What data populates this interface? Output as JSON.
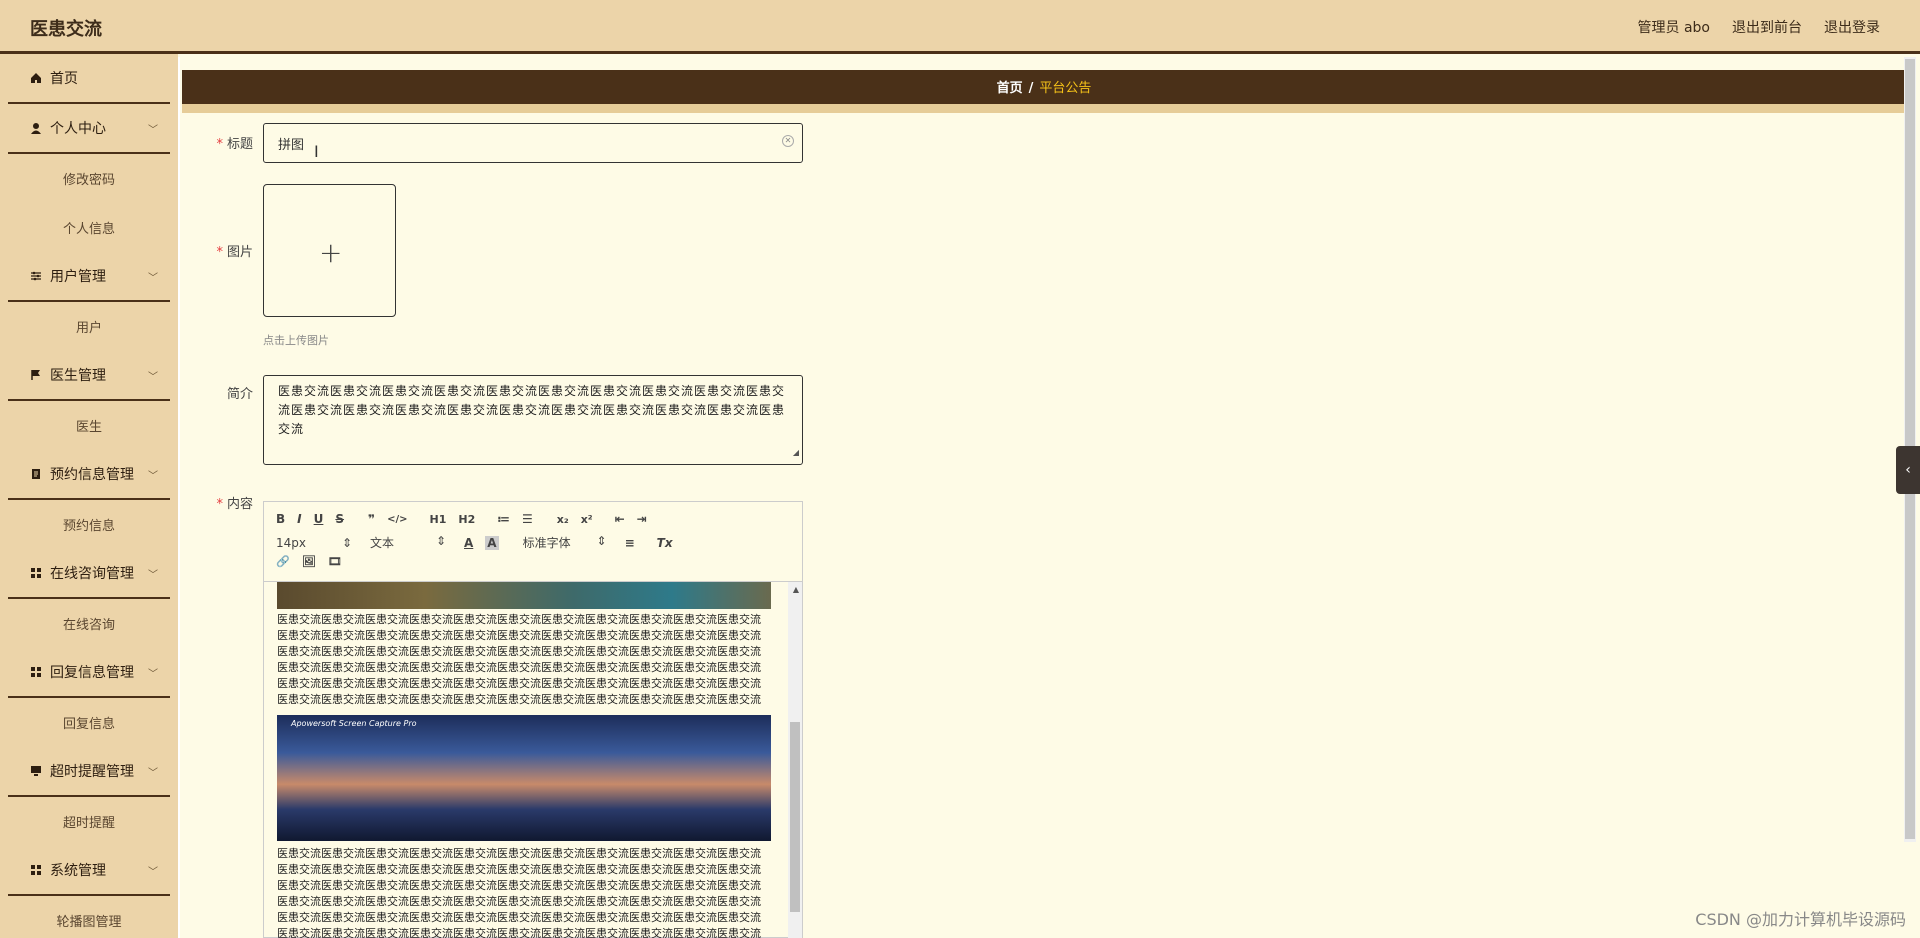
{
  "header": {
    "brand": "医患交流",
    "nav": [
      "管理员 abo",
      "退出到前台",
      "退出登录"
    ]
  },
  "sidebar": {
    "sections": [
      {
        "label": "首页",
        "icon": "home-icon",
        "has_arrow": false,
        "items": []
      },
      {
        "label": "个人中心",
        "icon": "user-icon",
        "has_arrow": true,
        "items": [
          "修改密码",
          "个人信息"
        ]
      },
      {
        "label": "用户管理",
        "icon": "sliders-icon",
        "has_arrow": true,
        "items": [
          "用户"
        ]
      },
      {
        "label": "医生管理",
        "icon": "flag-icon",
        "has_arrow": true,
        "items": [
          "医生"
        ]
      },
      {
        "label": "预约信息管理",
        "icon": "document-icon",
        "has_arrow": true,
        "items": [
          "预约信息"
        ]
      },
      {
        "label": "在线咨询管理",
        "icon": "grid-icon",
        "has_arrow": true,
        "items": [
          "在线咨询"
        ]
      },
      {
        "label": "回复信息管理",
        "icon": "grid-icon",
        "has_arrow": true,
        "items": [
          "回复信息"
        ]
      },
      {
        "label": "超时提醒管理",
        "icon": "monitor-icon",
        "has_arrow": true,
        "items": [
          "超时提醒"
        ]
      },
      {
        "label": "系统管理",
        "icon": "grid-icon",
        "has_arrow": true,
        "items": [
          "轮播图管理"
        ]
      }
    ]
  },
  "breadcrumb": {
    "home": "首页",
    "separator": "/",
    "current": "平台公告"
  },
  "form": {
    "title_label": "标题",
    "title_value": "拼图",
    "image_label": "图片",
    "upload_tip": "点击上传图片",
    "intro_label": "简介",
    "intro_value": "医患交流医患交流医患交流医患交流医患交流医患交流医患交流医患交流医患交流医患交流医患交流医患交流医患交流医患交流医患交流医患交流医患交流医患交流医患交流医患交流",
    "content_label": "内容"
  },
  "editor": {
    "toolbar_row1": [
      "B",
      "I",
      "U",
      "S",
      "❞",
      "</>",
      "H1",
      "H2",
      "≔",
      "☰",
      "x₂",
      "x²",
      "⇤",
      "⇥"
    ],
    "font_size": "14px",
    "text_style": "文本",
    "font_family": "标准字体",
    "toolbar_row2_icons": [
      "A",
      "A",
      "≡",
      "Tx"
    ],
    "toolbar_row3": [
      "🔗",
      "🖼",
      "🎞"
    ],
    "content_text": "医患交流医患交流医患交流医患交流医患交流医患交流医患交流医患交流医患交流医患交流医患交流医患交流医患交流医患交流医患交流医患交流医患交流医患交流医患交流医患交流医患交流医患交流医患交流医患交流医患交流医患交流医患交流医患交流医患交流医患交流医患交流医患交流医患交流医患交流医患交流医患交流医患交流医患交流医患交流医患交流医患交流医患交流医患交流医患交流医患交流医患交流医患交流医患交流医患交流医患交流医患交流医患交流医患交流医患交流医患交流医患交流医患交流医患交流医患交流医患交流医患交流医患交流医患交流医患交流医患交流医患交流医患交流医患交流医患交流医患交流医患交流医患交流医患交流医患交流医患交流医患交流",
    "image_caption": "Apowersoft Screen Capture Pro"
  },
  "watermark": "CSDN @加力计算机毕设源码",
  "colors": {
    "header_bg": "#ecd4a9",
    "dark_brown": "#4a3018",
    "page_bg": "#fefbe6",
    "accent_yellow": "#f5c218",
    "required": "#e4393c"
  }
}
